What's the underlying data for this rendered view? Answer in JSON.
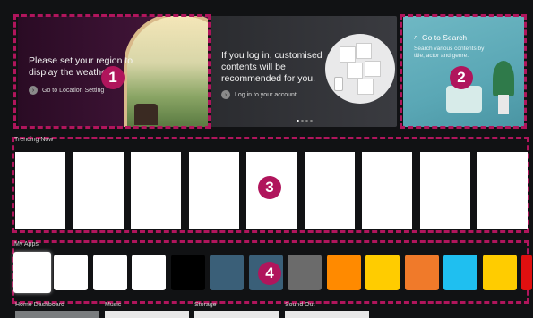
{
  "hero": {
    "weather": {
      "text": "Please set your region to display the weather.",
      "link_label": "Go to Location Setting"
    },
    "login": {
      "text": "If you log in, customised contents will be recommended for you.",
      "link_label": "Log in to your account"
    },
    "search": {
      "title": "Go to Search",
      "description": "Search various contents by title, actor and genre."
    }
  },
  "sections": {
    "trending": {
      "label": "Trending Now"
    },
    "apps": {
      "label": "My Apps"
    },
    "bottom": [
      "Home Dashboard",
      "Music",
      "Storage",
      "Sound Out"
    ]
  },
  "badges": [
    "1",
    "2",
    "3",
    "4"
  ],
  "app_tiles": [
    {
      "color": "#ffffff"
    },
    {
      "color": "#ffffff"
    },
    {
      "color": "#ffffff"
    },
    {
      "color": "#ffffff"
    },
    {
      "color": "#000000"
    },
    {
      "color": "#3a5f78"
    },
    {
      "color": "#3a5f78"
    },
    {
      "color": "#6b6b6b"
    },
    {
      "color": "#ff8a00"
    },
    {
      "color": "#ffcc00"
    },
    {
      "color": "#f07a2a"
    },
    {
      "color": "#1fbff0"
    },
    {
      "color": "#ffcc00"
    },
    {
      "color": "#e01010"
    }
  ],
  "pager_dots": 4
}
